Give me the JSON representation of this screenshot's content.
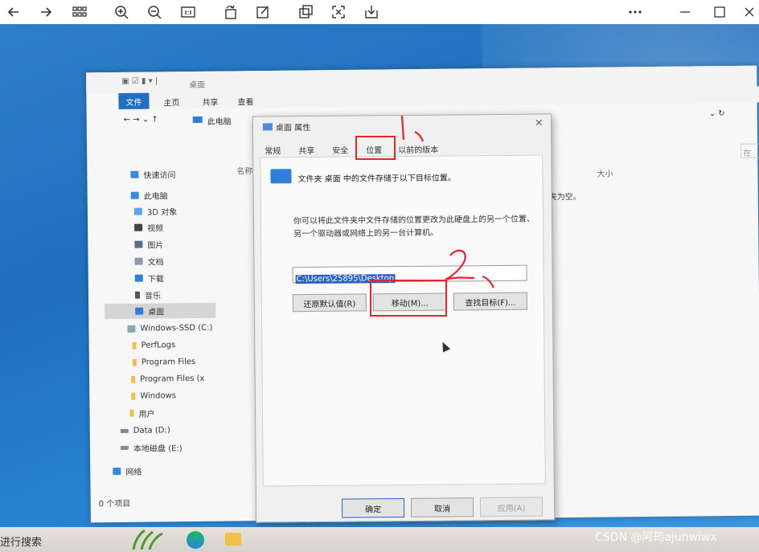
{
  "viewer": {
    "icons": [
      "back-icon",
      "forward-icon",
      "grid-icon",
      "zoom-in-icon",
      "zoom-out-icon",
      "actual-size-icon",
      "rotate-icon",
      "edit-icon",
      "crop-icon",
      "fullscreen-icon",
      "save-icon",
      "more-icon",
      "minimize-icon",
      "maximize-icon",
      "close-icon"
    ]
  },
  "explorer": {
    "title": "桌面",
    "ribbon": {
      "file": "文件",
      "tabs": [
        "主页",
        "共享",
        "查看"
      ]
    },
    "address": {
      "crumb": "此电脑",
      "search": "在"
    },
    "column_name": "名称",
    "column_size": "大小",
    "empty_note": "夹为空。",
    "nav": [
      {
        "label": "快速访问"
      },
      {
        "label": "此电脑"
      },
      {
        "label": "3D 对象"
      },
      {
        "label": "视频"
      },
      {
        "label": "图片"
      },
      {
        "label": "文档"
      },
      {
        "label": "下载"
      },
      {
        "label": "音乐"
      },
      {
        "label": "桌面"
      },
      {
        "label": "Windows-SSD (C:)"
      },
      {
        "label": "PerfLogs"
      },
      {
        "label": "Program Files"
      },
      {
        "label": "Program Files (x"
      },
      {
        "label": "Windows"
      },
      {
        "label": "用户"
      },
      {
        "label": "Data (D:)"
      },
      {
        "label": "本地磁盘 (E:)"
      },
      {
        "label": "网络"
      }
    ],
    "status": "0 个项目"
  },
  "dialog": {
    "title": "桌面 属性",
    "close": "×",
    "tabs": [
      "常规",
      "共享",
      "安全",
      "位置",
      "以前的版本"
    ],
    "active_tab": "位置",
    "desc_line": "文件夹 桌面 中的文件存储于以下目标位置。",
    "desc_long": "你可以将此文件夹中文件存储的位置更改为此硬盘上的另一个位置、另一个驱动器或网络上的另一台计算机。",
    "path": "C:\\Users\\25895\\Desktop",
    "buttons": {
      "restore": "还原默认值(R)",
      "move": "移动(M)...",
      "find": "查找目标(F)...",
      "ok": "确定",
      "cancel": "取消",
      "apply": "应用(A)"
    }
  },
  "annotations": {
    "step1": "1",
    "step2": "2",
    "color": "#e8242a"
  },
  "taskbar": {
    "search": "进行搜索"
  },
  "watermark": "CSDN @阿筠ajunwiwx"
}
